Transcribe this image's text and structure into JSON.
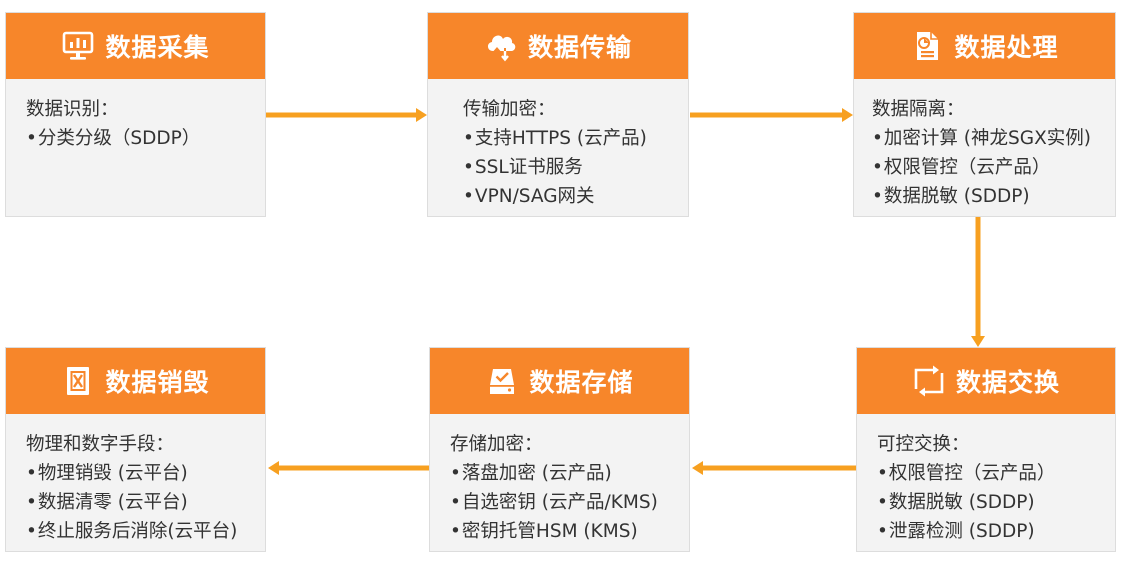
{
  "colors": {
    "header": "#f7862a",
    "card_bg": "#f3f3f3",
    "arrow": "#f7a020",
    "text": "#333333"
  },
  "stages": [
    {
      "title": "数据采集",
      "icon": "monitor-chart-icon",
      "heading": "数据识别：",
      "items": [
        "分类分级（SDDP）"
      ]
    },
    {
      "title": "数据传输",
      "icon": "cloud-transfer-icon",
      "heading": "传输加密：",
      "items": [
        "支持HTTPS (云产品)",
        "SSL证书服务",
        "VPN/SAG网关"
      ]
    },
    {
      "title": "数据处理",
      "icon": "document-chart-icon",
      "heading": "数据隔离：",
      "items": [
        "加密计算 (神龙SGX实例)",
        "权限管控（云产品）",
        "数据脱敏 (SDDP)"
      ]
    },
    {
      "title": "数据交换",
      "icon": "exchange-icon",
      "heading": "可控交换：",
      "items": [
        "权限管控（云产品）",
        "数据脱敏 (SDDP)",
        "泄露检测 (SDDP)"
      ]
    },
    {
      "title": "数据存储",
      "icon": "storage-check-icon",
      "heading": "存储加密：",
      "items": [
        "落盘加密 (云产品)",
        "自选密钥 (云产品/KMS)",
        "密钥托管HSM (KMS)"
      ]
    },
    {
      "title": "数据销毁",
      "icon": "trash-icon",
      "heading": "物理和数字手段：",
      "items": [
        "物理销毁 (云平台)",
        "数据清零 (云平台)",
        "终止服务后消除(云平台)"
      ]
    }
  ]
}
